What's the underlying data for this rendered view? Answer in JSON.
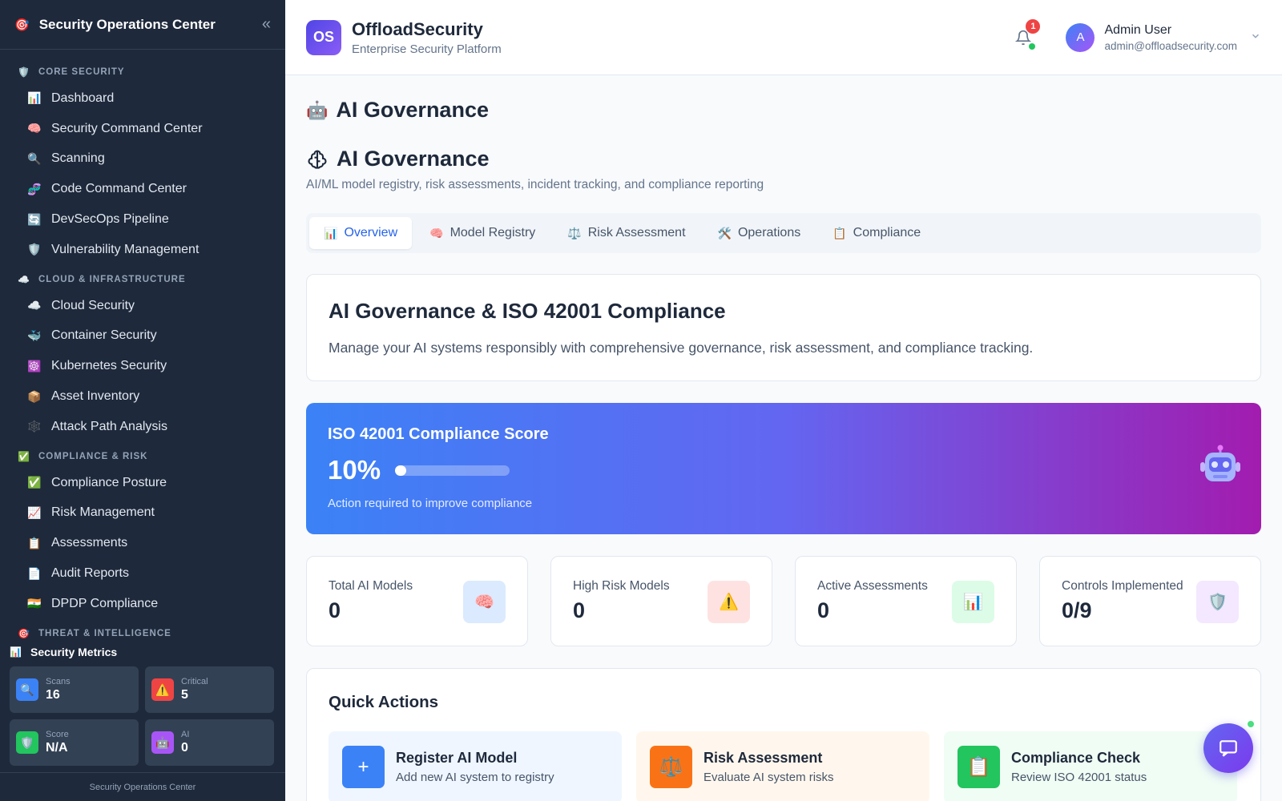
{
  "sidebar": {
    "title": "Security Operations Center",
    "logo_emoji": "🎯",
    "collapse_glyph": "«",
    "sections": [
      {
        "label": "CORE SECURITY",
        "icon": "🛡️",
        "items": [
          {
            "icon": "📊",
            "label": "Dashboard"
          },
          {
            "icon": "🧠",
            "label": "Security Command Center"
          },
          {
            "icon": "🔍",
            "label": "Scanning"
          },
          {
            "icon": "🧬",
            "label": "Code Command Center"
          },
          {
            "icon": "🔄",
            "label": "DevSecOps Pipeline"
          },
          {
            "icon": "🛡️",
            "label": "Vulnerability Management"
          }
        ]
      },
      {
        "label": "CLOUD & INFRASTRUCTURE",
        "icon": "☁️",
        "items": [
          {
            "icon": "☁️",
            "label": "Cloud Security"
          },
          {
            "icon": "🐳",
            "label": "Container Security"
          },
          {
            "icon": "☸️",
            "label": "Kubernetes Security"
          },
          {
            "icon": "📦",
            "label": "Asset Inventory"
          },
          {
            "icon": "🕸️",
            "label": "Attack Path Analysis"
          }
        ]
      },
      {
        "label": "COMPLIANCE & RISK",
        "icon": "✅",
        "items": [
          {
            "icon": "✅",
            "label": "Compliance Posture"
          },
          {
            "icon": "📈",
            "label": "Risk Management"
          },
          {
            "icon": "📋",
            "label": "Assessments"
          },
          {
            "icon": "📄",
            "label": "Audit Reports"
          },
          {
            "icon": "🇮🇳",
            "label": "DPDP Compliance"
          }
        ]
      },
      {
        "label": "THREAT & INTELLIGENCE",
        "icon": "🎯",
        "items": []
      }
    ],
    "metrics": {
      "title": "Security Metrics",
      "icon": "📊",
      "cards": [
        {
          "label": "Scans",
          "value": "16",
          "icon": "🔍",
          "color": "#3b82f6"
        },
        {
          "label": "Critical",
          "value": "5",
          "icon": "⚠️",
          "color": "#ef4444"
        },
        {
          "label": "Score",
          "value": "N/A",
          "icon": "🛡️",
          "color": "#22c55e"
        },
        {
          "label": "AI",
          "value": "0",
          "icon": "🤖",
          "color": "#a855f7"
        }
      ]
    },
    "footer": "Security Operations Center"
  },
  "header": {
    "brand_initials": "OS",
    "brand_name": "OffloadSecurity",
    "brand_subtitle": "Enterprise Security Platform",
    "notification_count": "1",
    "user_initial": "A",
    "user_name": "Admin User",
    "user_email": "admin@offloadsecurity.com"
  },
  "page": {
    "title_emoji": "🤖",
    "title": "AI Governance",
    "section_title": "AI Governance",
    "section_subtitle": "AI/ML model registry, risk assessments, incident tracking, and compliance reporting",
    "tabs": [
      {
        "icon": "📊",
        "label": "Overview",
        "active": true
      },
      {
        "icon": "🧠",
        "label": "Model Registry",
        "active": false
      },
      {
        "icon": "⚖️",
        "label": "Risk Assessment",
        "active": false
      },
      {
        "icon": "🛠️",
        "label": "Operations",
        "active": false
      },
      {
        "icon": "📋",
        "label": "Compliance",
        "active": false
      }
    ],
    "intro": {
      "title": "AI Governance & ISO 42001 Compliance",
      "text": "Manage your AI systems responsibly with comprehensive governance, risk assessment, and compliance tracking."
    },
    "score": {
      "title": "ISO 42001 Compliance Score",
      "value": "10%",
      "progress": 0.1,
      "note": "Action required to improve compliance"
    },
    "stats": [
      {
        "label": "Total AI Models",
        "value": "0",
        "icon": "🧠",
        "bg": "#dbeafe"
      },
      {
        "label": "High Risk Models",
        "value": "0",
        "icon": "⚠️",
        "bg": "#fee2e2"
      },
      {
        "label": "Active Assessments",
        "value": "0",
        "icon": "📊",
        "bg": "#dcfce7"
      },
      {
        "label": "Controls Implemented",
        "value": "0/9",
        "icon": "🛡️",
        "bg": "#f3e8ff"
      }
    ],
    "quick_actions": {
      "title": "Quick Actions",
      "items": [
        {
          "title": "Register AI Model",
          "desc": "Add new AI system to registry",
          "icon": "+",
          "color": "#3b82f6",
          "bg": "#eff6ff"
        },
        {
          "title": "Risk Assessment",
          "desc": "Evaluate AI system risks",
          "icon": "⚖️",
          "color": "#f97316",
          "bg": "#fff7ed"
        },
        {
          "title": "Compliance Check",
          "desc": "Review ISO 42001 status",
          "icon": "📋",
          "color": "#22c55e",
          "bg": "#f0fdf4"
        }
      ]
    }
  }
}
